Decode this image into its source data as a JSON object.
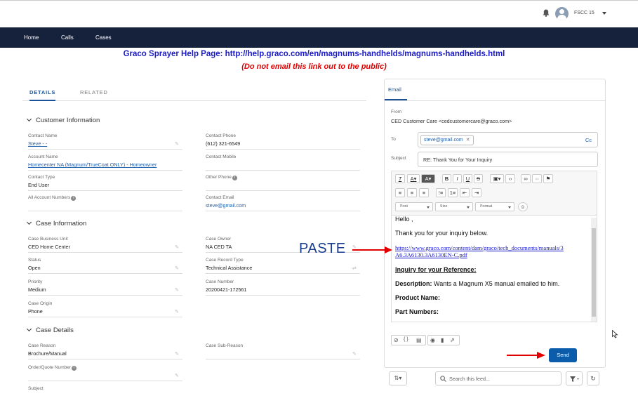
{
  "header": {
    "user_label": "FSCC 15"
  },
  "nav": {
    "items": [
      "Home",
      "Calls",
      "Cases"
    ]
  },
  "banner": {
    "help": "Graco Sprayer Help Page: http://help.graco.com/en/magnums-handhelds/magnums-handhelds.html",
    "warning": "(Do not email this link out to the public)"
  },
  "tabs": {
    "details": "DETAILS",
    "related": "RELATED"
  },
  "sections": {
    "customer": "Customer Information",
    "case_info": "Case Information",
    "case_details": "Case Details"
  },
  "customer": {
    "contact_name_label": "Contact Name",
    "contact_name": "Steve - -",
    "contact_phone_label": "Contact Phone",
    "contact_phone": "(612) 321-6549",
    "account_name_label": "Account Name",
    "account_name": "Homecenter NA (Magnum/TrueCoat ONLY) - Homeowner",
    "contact_mobile_label": "Contact Mobile",
    "contact_type_label": "Contact Type",
    "contact_type": "End User",
    "other_phone_label": "Other Phone",
    "all_account_numbers_label": "All Account Numbers",
    "contact_email_label": "Contact Email",
    "contact_email": "steve@gmail.com"
  },
  "case_info": {
    "business_unit_label": "Case Business Unit",
    "business_unit": "CED Home Center",
    "owner_label": "Case Owner",
    "owner": "NA CED TA",
    "status_label": "Status",
    "status": "Open",
    "record_type_label": "Case Record Type",
    "record_type": "Technical Assistance",
    "priority_label": "Priority",
    "priority": "Medium",
    "case_number_label": "Case Number",
    "case_number": "20200421-172561",
    "origin_label": "Case Origin",
    "origin": "Phone"
  },
  "case_details": {
    "reason_label": "Case Reason",
    "reason": "Brochure/Manual",
    "sub_reason_label": "Case Sub-Reason",
    "order_label": "Order/Quote Number",
    "subject_label": "Subject"
  },
  "email": {
    "tab": "Email",
    "from_label": "From",
    "from_value": "CED Customer Care <cedcustomercare@graco.com>",
    "to_label": "To",
    "to_pill": "steve@gmail.com",
    "cc_label": "Cc",
    "subject_label": "Subject",
    "subject_value": "RE: Thank You for Your Inquiry",
    "font_label": "Font",
    "size_label": "Size",
    "format_label": "Format",
    "body": {
      "greeting": "Hello ,",
      "thanks": "Thank you for your inquiry below.",
      "link_line1": "https://www.graco.com/content/dam/graco/tech_documents/manuals/3",
      "link_line2": "A6.3A6130.3A6130EN-C.pdf",
      "inquiry_heading": "Inquiry for your Reference:",
      "description_label": "Description:",
      "description_value": "Wants a Magnum X5 manual emailed to him.",
      "product_label": "Product Name:",
      "parts_label": "Part Numbers:"
    },
    "send_label": "Send"
  },
  "feed": {
    "search_placeholder": "Search this feed..."
  },
  "annotation": {
    "paste_label": "PASTE"
  },
  "colors": {
    "nav_bg": "#16213b",
    "brand_blue": "#0b5cab",
    "link": "#1f5fad",
    "warning_red": "#e00000",
    "arrow_red": "#e00000"
  }
}
